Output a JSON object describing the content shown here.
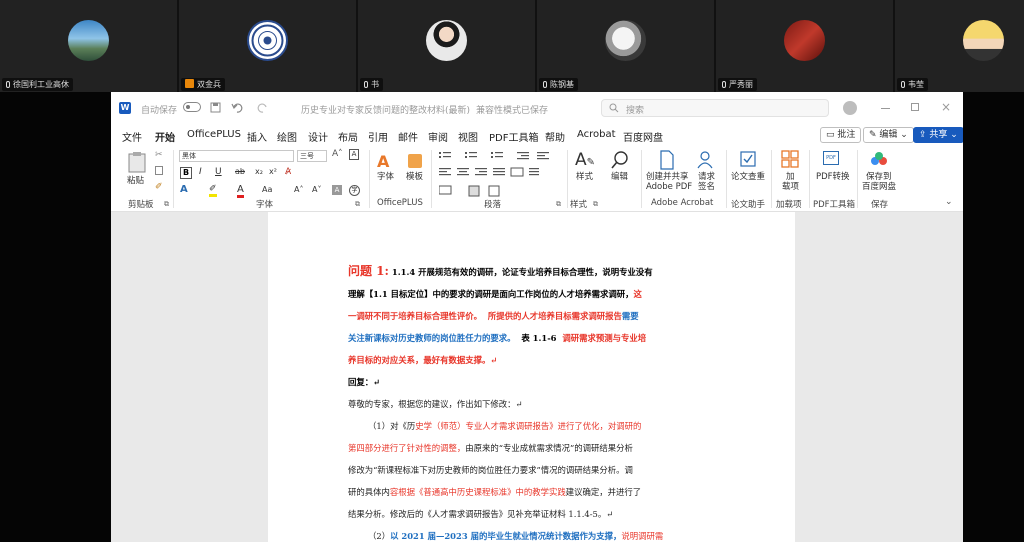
{
  "participants": [
    {
      "name": "徐国利工业高休",
      "icon": "mic-icon"
    },
    {
      "name": "双金兵",
      "icon": "user-icon"
    },
    {
      "name": "书",
      "icon": "mic-icon"
    },
    {
      "name": "陈钢基",
      "icon": "mic-icon"
    },
    {
      "name": "严秀丽",
      "icon": "mic-icon"
    },
    {
      "name": "韦莹",
      "icon": "mic-icon"
    }
  ],
  "word": {
    "title": {
      "autosave": "自动保存",
      "autosave_state": "关",
      "doc_name": "历史专业对专家反馈问题的整改材料(最新)",
      "mode": "兼容性模式",
      "saved": "已保存",
      "search_placeholder": "搜索"
    },
    "menu": [
      "文件",
      "开始",
      "OfficePLUS",
      "插入",
      "绘图",
      "设计",
      "布局",
      "引用",
      "邮件",
      "审阅",
      "视图",
      "PDF工具箱",
      "帮助",
      "Acrobat",
      "百度网盘"
    ],
    "buttons": {
      "comments": "批注",
      "edit": "编辑",
      "share": "共享"
    },
    "ribbon": {
      "clipboard": {
        "paste": "粘贴",
        "label": "剪贴板"
      },
      "font": {
        "name": "黑体",
        "size": "三号",
        "label": "字体"
      },
      "officeplus": {
        "font": "字体",
        "template": "模板",
        "label": "OfficePLUS"
      },
      "paragraph": {
        "label": "段落"
      },
      "styles": {
        "style": "样式",
        "label": "样式"
      },
      "editing": {
        "edit": "编辑"
      },
      "acrobat": {
        "create": "创建并共享",
        "create2": "Adobe PDF",
        "request": "请求",
        "request2": "签名",
        "label": "Adobe Acrobat"
      },
      "paper": {
        "check": "论文查重",
        "label": "论文助手"
      },
      "addins": {
        "add": "加",
        "add2": "载项",
        "label": "加载项"
      },
      "pdf": {
        "convert": "PDF转换",
        "label": "PDF工具箱"
      },
      "save": {
        "save": "保存到",
        "save2": "百度网盘",
        "label": "保存"
      }
    }
  },
  "doc": {
    "q_label": "问题 1:",
    "l1": "1.1.4 开展规范有效的调研，论证专业培养目标合理性，说明专业没有",
    "l2a": "理解【1.1 目标定位】中的要求的调研是面向工作岗位的人才培养需求调研，",
    "l2b": "这",
    "l3a": "一调研不同于培养目标合理性评价。",
    "l3b": "所提供的人才培养目标需求调研报告",
    "l3c": "需要",
    "l4a": "关注新课标对历史教师的岗位胜任力的要求。",
    "l4b": "表 1.1-6",
    "l4c": "调研需求预测与专业培",
    "l5": "养目标的对应关系，最好有数据支撑。↵",
    "reply": "回复：↵",
    "l7": "尊敬的专家，根据您的建议，作出如下修改：↵",
    "l8a": "（1）对《历",
    "l8b": "史学（师范）专业人才需求调研报告》进行了优化，对调研的",
    "l9a": "第四部分进行了针对性的调整，",
    "l9b": "由原来的“专业成就需求情况”的调研结果分析",
    "l10": "修改为“新课程标准下对历史教师的岗位胜任力要求”情况的调研结果分析。调",
    "l11a": "研的具体内",
    "l11b": "容根据《普通高中历史课程标准》中的教学实践",
    "l11c": "建议确定，并进行了",
    "l12": "结果分析。修改后的《人才需求调研报告》见补充举证材料 1.1.4-5。↵",
    "l13a": "（2）",
    "l13b": "以 2021 届—2023 届的毕业生就业情况统计数据作为支撑，",
    "l13c": "说明调研需"
  }
}
